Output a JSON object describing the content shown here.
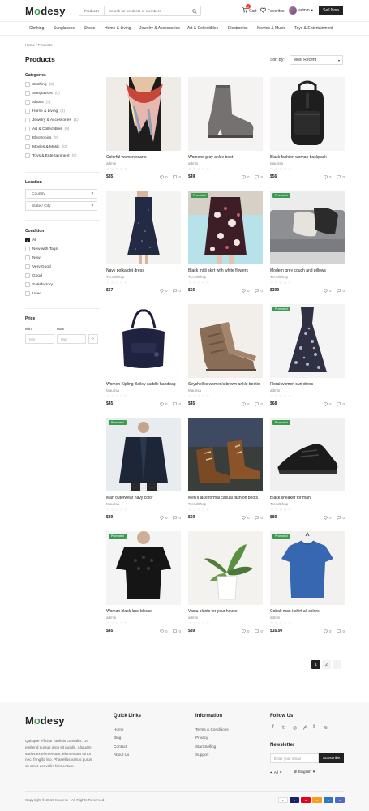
{
  "header": {
    "logo_prefix": "M",
    "logo_o": "o",
    "logo_suffix": "desy",
    "search_category": "Product",
    "search_placeholder": "Search for products or members",
    "cart_label": "Cart",
    "cart_count": "2",
    "favorites_label": "Favorites",
    "user_label": "admin",
    "sell_label": "Sell Now"
  },
  "nav": [
    "Clothing",
    "Sunglasses",
    "Shoes",
    "Home & Living",
    "Jewelry & Accessories",
    "Art & Collectibles",
    "Electronics",
    "Movies & Music",
    "Toys & Entertainment"
  ],
  "breadcrumb": "Home / Products",
  "page_title": "Products",
  "sort": {
    "label": "Sort By:",
    "value": "Most Recent"
  },
  "sidebar": {
    "categories_title": "Categories",
    "categories": [
      {
        "label": "Clothing",
        "count": "(8)"
      },
      {
        "label": "Sunglasses",
        "count": "(0)"
      },
      {
        "label": "Shoes",
        "count": "(4)"
      },
      {
        "label": "Home & Living",
        "count": "(3)"
      },
      {
        "label": "Jewelry & Accessories",
        "count": "(1)"
      },
      {
        "label": "Art & Collectibles",
        "count": "(0)"
      },
      {
        "label": "Electronics",
        "count": "(0)"
      },
      {
        "label": "Movies & Music",
        "count": "(0)"
      },
      {
        "label": "Toys & Entertainment",
        "count": "(0)"
      }
    ],
    "location_title": "Location",
    "country_label": "Country",
    "state_label": "State / City",
    "condition_title": "Condition",
    "conditions": [
      "All",
      "New with Tags",
      "New",
      "Very Good",
      "Good",
      "Satisfactory",
      "Used"
    ],
    "price_title": "Price",
    "min_label": "Min",
    "max_label": "Max",
    "min_placeholder": "Min",
    "max_placeholder": "Max",
    "go_label": "›"
  },
  "promoted_label": "Promoted",
  "products": [
    {
      "title": "Colorful women scarfs",
      "seller": "admin",
      "price": "$35",
      "likes": "0",
      "comments": "0",
      "promoted": false,
      "img": "scarf"
    },
    {
      "title": "Womens gray ankle boot",
      "seller": "admin",
      "price": "$49",
      "likes": "0",
      "comments": "0",
      "promoted": false,
      "img": "boot"
    },
    {
      "title": "Black fashion woman backpack",
      "seller": "Maurisa",
      "price": "$56",
      "likes": "0",
      "comments": "0",
      "promoted": false,
      "img": "backpack"
    },
    {
      "title": "Navy polka dot dress",
      "seller": "TrendShop",
      "price": "$67",
      "likes": "0",
      "comments": "0",
      "promoted": false,
      "img": "navydress"
    },
    {
      "title": "Black midi skirt with white flowers",
      "seller": "TrendShop",
      "price": "$56",
      "likes": "0",
      "comments": "0",
      "promoted": true,
      "img": "skirt"
    },
    {
      "title": "Modern grey couch and pillows",
      "seller": "TrendShop",
      "price": "$399",
      "likes": "0",
      "comments": "0",
      "promoted": true,
      "img": "couch"
    },
    {
      "title": "Women Kipling Bailey saddle handbag",
      "seller": "Maurisa",
      "price": "$45",
      "likes": "0",
      "comments": "0",
      "promoted": false,
      "img": "handbag"
    },
    {
      "title": "Seychelles women's brown ankle bootie",
      "seller": "Maurisa",
      "price": "$45",
      "likes": "0",
      "comments": "0",
      "promoted": false,
      "img": "bootie"
    },
    {
      "title": "Floral women sun dress",
      "seller": "admin",
      "price": "$68",
      "likes": "0",
      "comments": "0",
      "promoted": true,
      "img": "floraldress"
    },
    {
      "title": "Man outerwear navy color",
      "seller": "Maurisa",
      "price": "$39",
      "likes": "0",
      "comments": "0",
      "promoted": true,
      "img": "jacket"
    },
    {
      "title": "Men's lace formal casual fashion boots",
      "seller": "TrendShop",
      "price": "$69",
      "likes": "0",
      "comments": "0",
      "promoted": false,
      "img": "menboots"
    },
    {
      "title": "Black sneaker for man",
      "seller": "TrendShop",
      "price": "$89",
      "likes": "0",
      "comments": "0",
      "promoted": true,
      "img": "sneaker"
    },
    {
      "title": "Woman black lace blouse",
      "seller": "admin",
      "price": "$45",
      "likes": "0",
      "comments": "0",
      "promoted": true,
      "img": "blouse"
    },
    {
      "title": "Vastu plants for your house",
      "seller": "admin",
      "price": "$89",
      "likes": "0",
      "comments": "0",
      "promoted": false,
      "img": "plant"
    },
    {
      "title": "Cobalt man t-shirt all colors",
      "seller": "admin",
      "price": "$16.90",
      "likes": "0",
      "comments": "0",
      "promoted": true,
      "img": "tshirt"
    }
  ],
  "pagination": {
    "current": "1",
    "next_page": "2",
    "next_arrow": "›"
  },
  "footer": {
    "about": "Quisque efficitur facilisis convallis. Ut eleifend cursus arcu sit iaculis. Aliquam varius ex elementum, elementum tortor nec, fringilla leo. Phasellus varius purus sit amet convallis fermentum.",
    "quick_links_title": "Quick Links",
    "quick_links": [
      "Home",
      "Blog",
      "Contact",
      "About Us"
    ],
    "information_title": "Information",
    "information": [
      "Terms & Conditions",
      "Privacy",
      "Start Selling",
      "Support"
    ],
    "follow_title": "Follow Us",
    "newsletter_title": "Newsletter",
    "email_placeholder": "Enter your email",
    "subscribe_label": "Subscribe",
    "region_label": "All",
    "language_label": "English",
    "copyright": "Copyright © 2019 Modesy - All Rights Reserved."
  },
  "colors": {
    "accent": "#3d9a53",
    "dark": "#222222",
    "promo": "#3d9a53"
  }
}
